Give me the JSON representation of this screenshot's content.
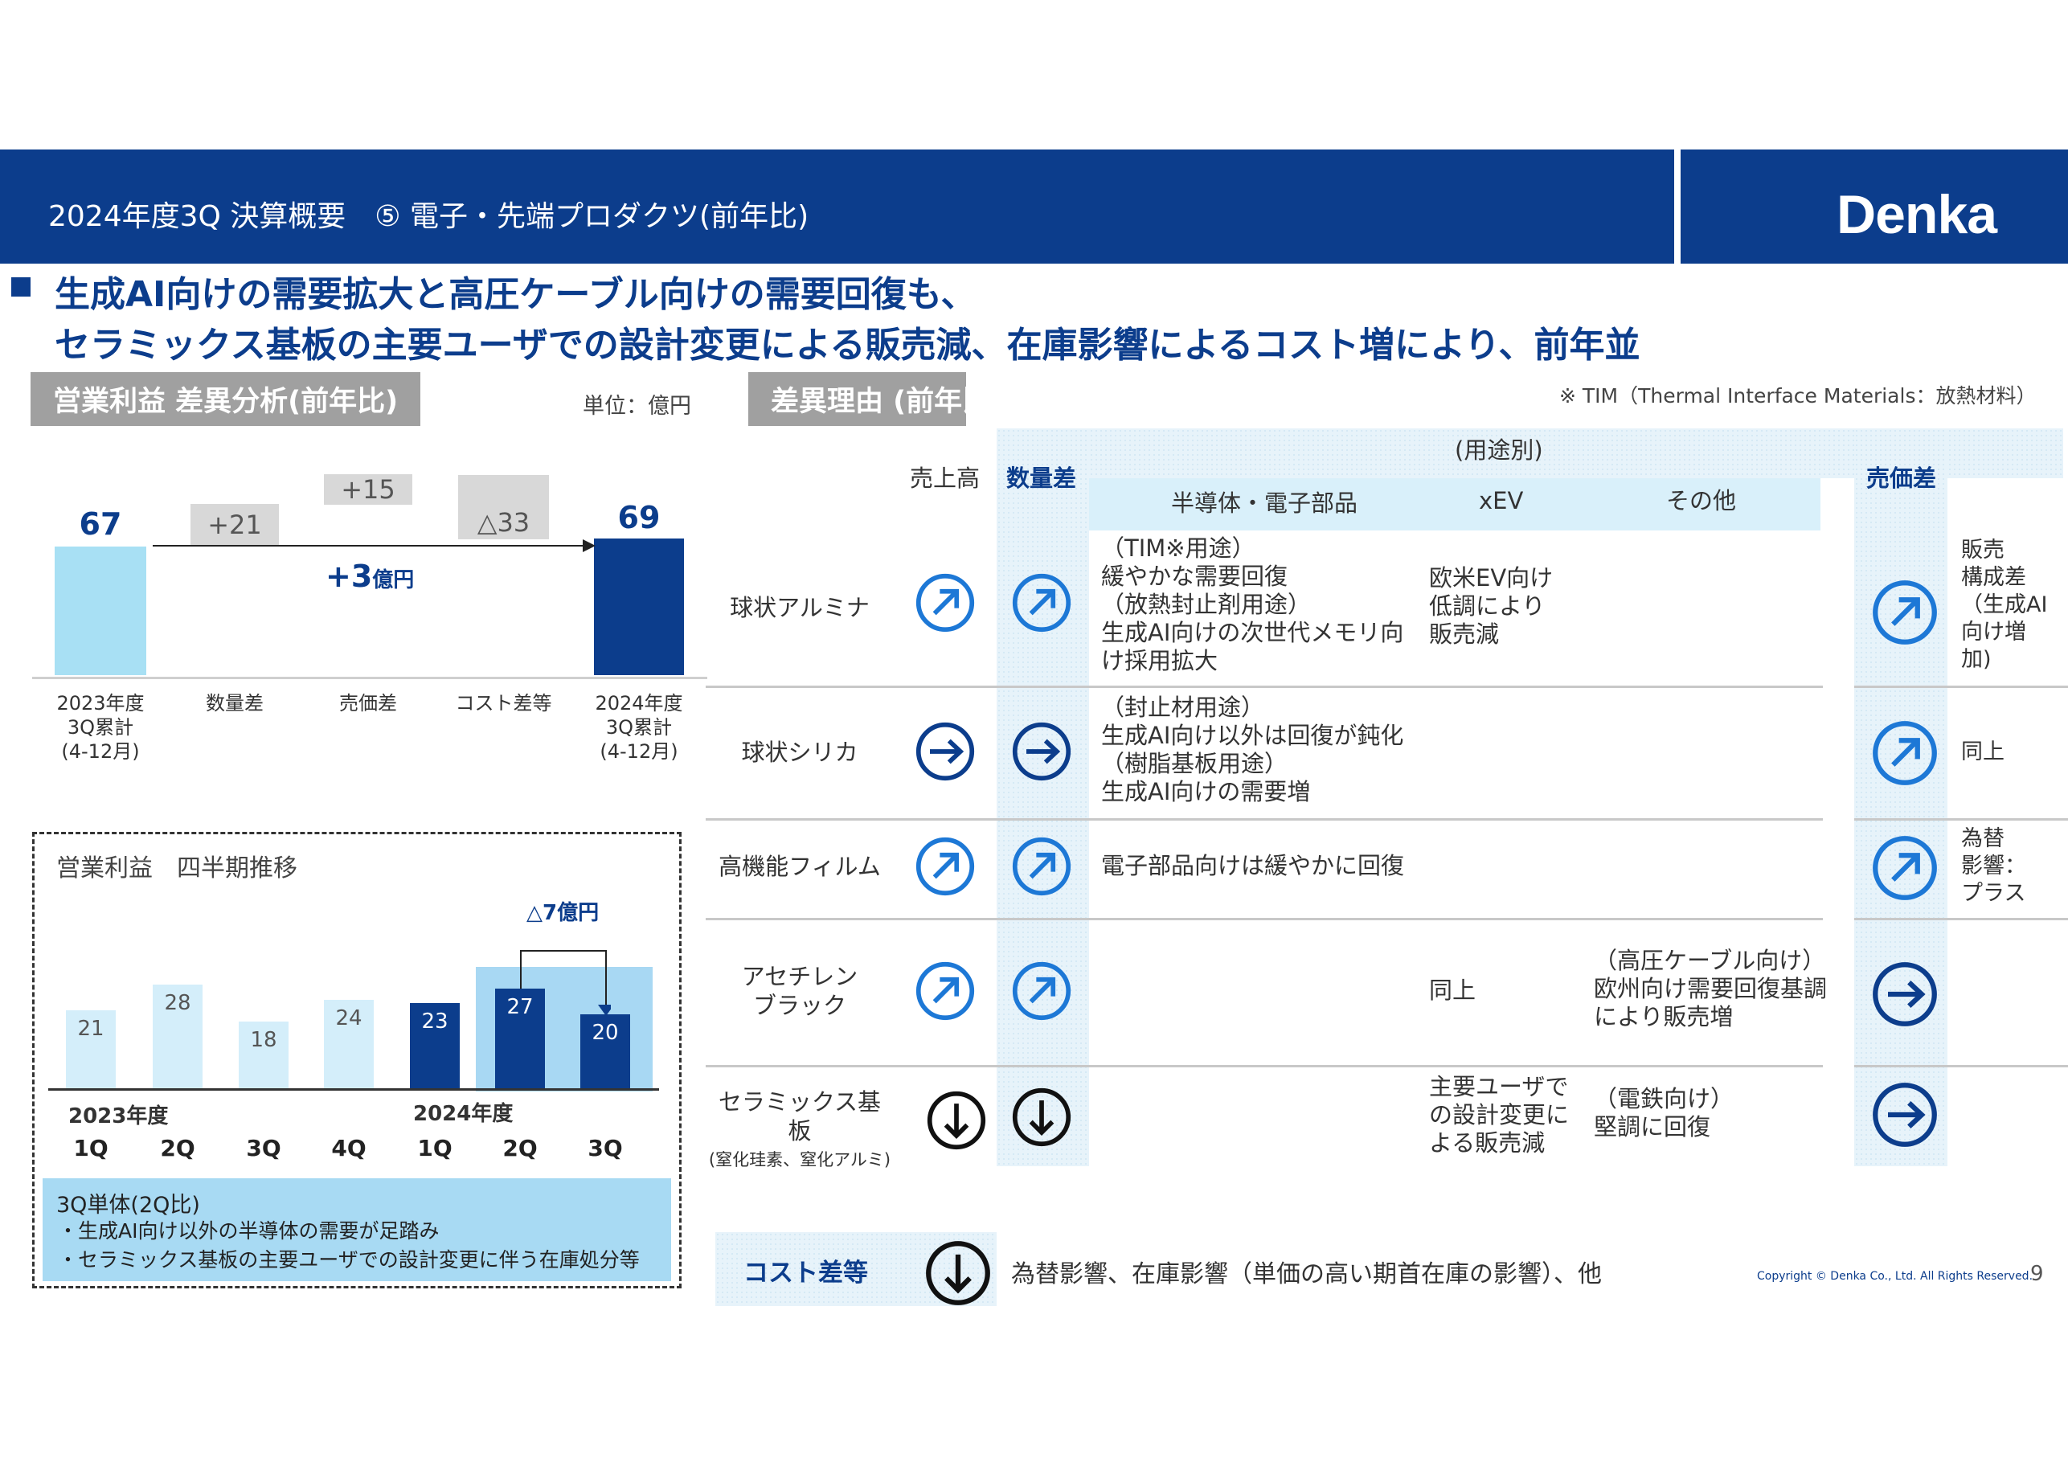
{
  "header": {
    "title": "2024年度3Q 決算概要　⑤ 電子・先端プロダクツ(前年比)",
    "logo": "Denka"
  },
  "headline": {
    "line1": "生成AI向けの需要拡大と高圧ケーブル向けの需要回復も、",
    "line2": "セラミックス基板の主要ユーザでの設計変更による販売減、在庫影響によるコスト増により、前年並"
  },
  "left": {
    "section_label": "営業利益 差異分析(前年比)",
    "unit": "単位：億円",
    "waterfall": {
      "start_value": "67",
      "end_value": "69",
      "total_change": "+3",
      "total_change_unit": "億円",
      "deltas": [
        "+21",
        "+15",
        "△33"
      ],
      "categories": [
        [
          "2023年度",
          "3Q累計",
          "(4-12月)"
        ],
        [
          "数量差"
        ],
        [
          "売価差"
        ],
        [
          "コスト差等"
        ],
        [
          "2024年度",
          "3Q累計",
          "(4-12月)"
        ]
      ]
    },
    "quarterly": {
      "title": "営業利益　四半期推移",
      "annotation": "△7億円",
      "x_labels": [
        "1Q",
        "2Q",
        "3Q",
        "4Q",
        "1Q",
        "2Q",
        "3Q"
      ],
      "years": [
        "2023年度",
        "2024年度"
      ],
      "note_title": "3Q単体(2Q比)",
      "note_lines": [
        "・生成AI向け以外の半導体の需要が足踏み",
        "・セラミックス基板の主要ユーザでの設計変更に伴う在庫処分等"
      ]
    }
  },
  "chart_data": [
    {
      "type": "bar",
      "title": "営業利益 差異分析(前年比)",
      "categories": [
        "2023年度 3Q累計 (4-12月)",
        "数量差",
        "売価差",
        "コスト差等",
        "2024年度 3Q累計 (4-12月)"
      ],
      "values": [
        67,
        21,
        15,
        -33,
        69
      ],
      "ylabel": "単位：億円"
    },
    {
      "type": "bar",
      "title": "営業利益　四半期推移",
      "categories": [
        "2023年度 1Q",
        "2023年度 2Q",
        "2023年度 3Q",
        "2023年度 4Q",
        "2024年度 1Q",
        "2024年度 2Q",
        "2024年度 3Q"
      ],
      "values": [
        21,
        28,
        18,
        24,
        23,
        27,
        20
      ]
    }
  ],
  "right": {
    "section_label": "差異理由 (前年比)",
    "tim_note": "※ TIM（Thermal Interface Materials：放熱材料）",
    "col_sales": "売上高",
    "col_volume": "数量差",
    "col_usage": "(用途別)",
    "col_semi": "半導体・電子部品",
    "col_xev": "xEV",
    "col_other": "その他",
    "col_price": "売価差",
    "rows": [
      {
        "name": "球状アルミナ",
        "semi": [
          "（TIM※用途）",
          "緩やかな需要回復",
          "（放熱封止剤用途）",
          "生成AI向けの次世代メモリ向",
          "け採用拡大"
        ],
        "xev": [
          "欧米EV向け",
          "低調により",
          "販売減"
        ],
        "other": [],
        "price_note": [
          "販売",
          "構成差",
          "（生成AI",
          "向け増",
          "加)"
        ]
      },
      {
        "name": "球状シリカ",
        "semi": [
          "（封止材用途）",
          "生成AI向け以外は回復が鈍化",
          "（樹脂基板用途）",
          "生成AI向けの需要増"
        ],
        "xev": [],
        "other": [],
        "price_note": [
          "同上"
        ]
      },
      {
        "name": "高機能フィルム",
        "semi": [
          "電子部品向けは緩やかに回復"
        ],
        "xev": [],
        "other": [],
        "price_note": [
          "為替",
          "影響：",
          "プラス"
        ]
      },
      {
        "name": "アセチレン\nブラック",
        "semi": [],
        "xev": [
          "同上"
        ],
        "other": [
          "（高圧ケーブル向け）",
          "欧州向け需要回復基調",
          "により販売増"
        ],
        "price_note": []
      },
      {
        "name": "セラミックス基板",
        "name_sub": "(窒化珪素、窒化アルミ)",
        "semi": [],
        "xev": [
          "主要ユーザで",
          "の設計変更に",
          "よる販売減"
        ],
        "other": [
          "（電鉄向け）",
          "堅調に回復"
        ],
        "price_note": []
      }
    ],
    "cost_label": "コスト差等",
    "cost_text": "為替影響、在庫影響（単価の高い期首在庫の影響）、他"
  },
  "footer": {
    "copyright": "Copyright © Denka Co., Ltd. All Rights Reserved.",
    "page": "9"
  },
  "colors": {
    "navy": "#0c3d8c",
    "light_blue": "#a8ddf3",
    "pale_blue": "#d4eefa",
    "icon_blue": "#1d78d6",
    "grey": "#a0a0a0"
  }
}
